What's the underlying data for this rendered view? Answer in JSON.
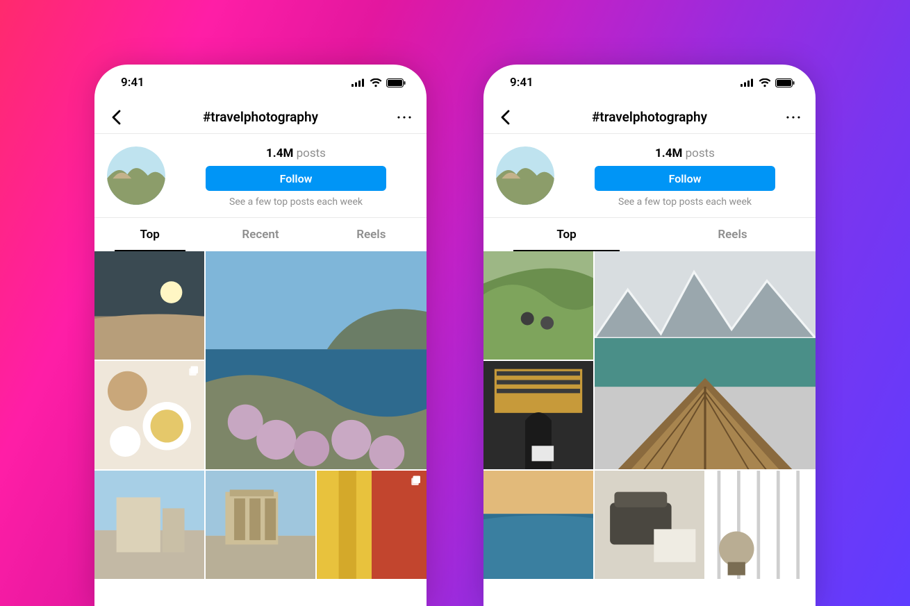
{
  "statusbar": {
    "time": "9:41"
  },
  "header": {
    "title": "#travelphotography"
  },
  "info": {
    "posts_count": "1.4M",
    "posts_label": "posts",
    "follow_label": "Follow",
    "hint": "See a few top posts each week"
  },
  "phones": [
    {
      "tabs": [
        {
          "label": "Top",
          "active": true
        },
        {
          "label": "Recent",
          "active": false
        },
        {
          "label": "Reels",
          "active": false
        }
      ]
    },
    {
      "tabs": [
        {
          "label": "Top",
          "active": true
        },
        {
          "label": "Reels",
          "active": false
        }
      ]
    }
  ]
}
